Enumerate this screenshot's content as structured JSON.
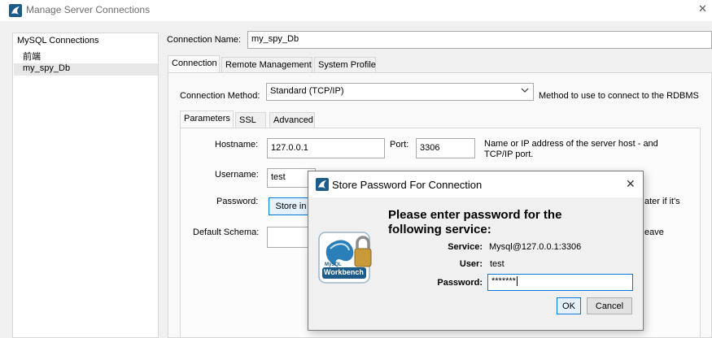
{
  "window": {
    "title": "Manage Server Connections",
    "close_glyph": "✕"
  },
  "sidebar": {
    "header": "MySQL Connections",
    "items": [
      {
        "label": "前端"
      },
      {
        "label": "my_spy_Db"
      }
    ]
  },
  "connection_name": {
    "label": "Connection Name:",
    "value": "my_spy_Db"
  },
  "main_tabs": [
    {
      "label": "Connection"
    },
    {
      "label": "Remote Management"
    },
    {
      "label": "System Profile"
    }
  ],
  "connection_method": {
    "label": "Connection Method:",
    "value": "Standard (TCP/IP)",
    "hint": "Method to use to connect to the RDBMS"
  },
  "sub_tabs": [
    {
      "label": "Parameters"
    },
    {
      "label": "SSL"
    },
    {
      "label": "Advanced"
    }
  ],
  "params": {
    "hostname_label": "Hostname:",
    "hostname_value": "127.0.0.1",
    "port_label": "Port:",
    "port_value": "3306",
    "host_hint": "Name or IP address of the server host - and TCP/IP port.",
    "username_label": "Username:",
    "username_value": "test",
    "password_label": "Password:",
    "store_button": "Store in",
    "password_hint_fragment": "ater if it's",
    "schema_label": "Default Schema:",
    "schema_hint_fragment": "eave"
  },
  "dialog": {
    "title": "Store Password For Connection",
    "close_glyph": "✕",
    "heading": "Please enter password for the following service:",
    "service_label": "Service:",
    "service_value": "Mysql@127.0.0.1:3306",
    "user_label": "User:",
    "user_value": "test",
    "password_label": "Password:",
    "password_value": "*******",
    "ok_button": "OK",
    "cancel_button": "Cancel",
    "logo_text_small": "MySQL",
    "logo_text": "Workbench"
  },
  "colors": {
    "accent": "#1d5b88",
    "focus_border": "#0078d7",
    "dialog_border": "#777777"
  }
}
